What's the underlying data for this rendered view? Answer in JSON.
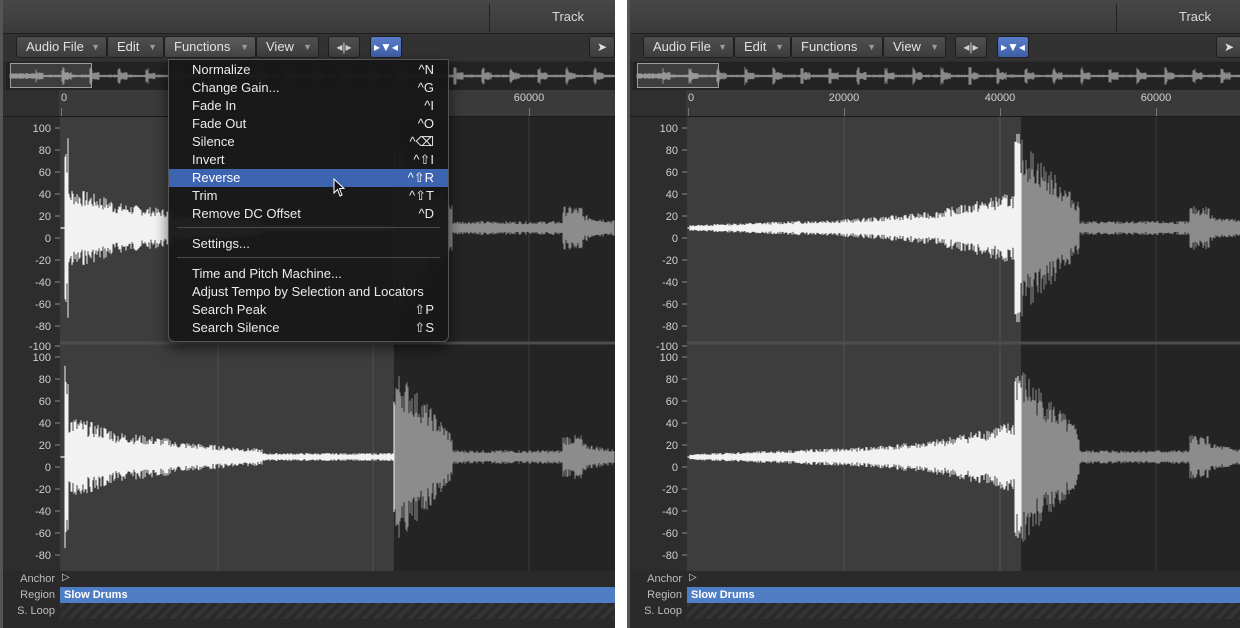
{
  "panels": [
    {
      "title": "Track",
      "menubar": {
        "audio_file": "Audio File",
        "edit": "Edit",
        "functions": "Functions",
        "view": "View"
      },
      "ruler": [
        "0",
        "60000"
      ],
      "y_axis": [
        "100",
        "80",
        "60",
        "40",
        "20",
        "0",
        "-20",
        "-40",
        "-60",
        "-80",
        "-100"
      ],
      "bottom": {
        "anchor": "Anchor",
        "region": "Region",
        "loop": "S. Loop",
        "region_name": "Slow Drums"
      }
    },
    {
      "title": "Track",
      "menubar": {
        "audio_file": "Audio File",
        "edit": "Edit",
        "functions": "Functions",
        "view": "View"
      },
      "ruler": [
        "0",
        "20000",
        "40000",
        "60000"
      ],
      "y_axis": [
        "100",
        "80",
        "60",
        "40",
        "20",
        "0",
        "-20",
        "-40",
        "-60",
        "-80",
        "-100"
      ],
      "bottom": {
        "anchor": "Anchor",
        "region": "Region",
        "loop": "S. Loop",
        "region_name": "Slow Drums"
      }
    }
  ],
  "functions_menu": {
    "items": [
      {
        "label": "Normalize",
        "shortcut": "^N"
      },
      {
        "label": "Change Gain...",
        "shortcut": "^G"
      },
      {
        "label": "Fade In",
        "shortcut": "^I"
      },
      {
        "label": "Fade Out",
        "shortcut": "^O"
      },
      {
        "label": "Silence",
        "shortcut": "^⌫"
      },
      {
        "label": "Invert",
        "shortcut": "^⇧I"
      },
      {
        "label": "Reverse",
        "shortcut": "^⇧R",
        "selected": true
      },
      {
        "label": "Trim",
        "shortcut": "^⇧T"
      },
      {
        "label": "Remove DC Offset",
        "shortcut": "^D"
      },
      {
        "label": "Settings...",
        "shortcut": ""
      },
      {
        "label": "Time and Pitch Machine...",
        "shortcut": ""
      },
      {
        "label": "Adjust Tempo by Selection and Locators",
        "shortcut": ""
      },
      {
        "label": "Search Peak",
        "shortcut": "⇧P"
      },
      {
        "label": "Search Silence",
        "shortcut": "⇧S"
      }
    ]
  },
  "icons": {
    "catch": "catch-playhead-icon",
    "flex": "flex-view-icon",
    "pointer": "pointer-tool-icon"
  },
  "colors": {
    "region": "#4f7ec4",
    "menu_highlight": "#3d64b1",
    "selection": "#3d3d3d",
    "waveform": "#f2f2f2"
  }
}
